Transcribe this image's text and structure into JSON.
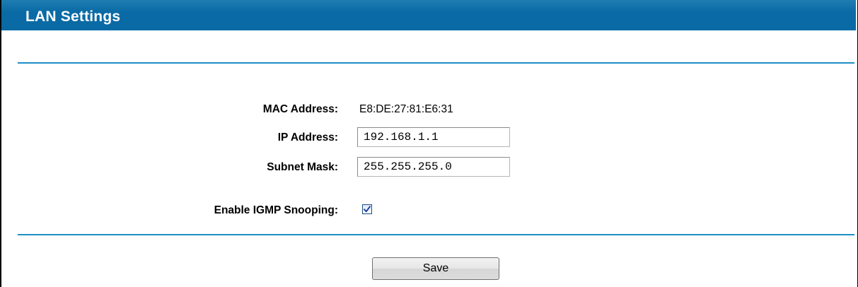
{
  "header": {
    "title": "LAN Settings"
  },
  "form": {
    "mac_address": {
      "label": "MAC Address:",
      "value": "E8:DE:27:81:E6:31"
    },
    "ip_address": {
      "label": "IP Address:",
      "value": "192.168.1.1"
    },
    "subnet_mask": {
      "label": "Subnet Mask:",
      "value": "255.255.255.0"
    },
    "igmp_snooping": {
      "label": "Enable IGMP Snooping:",
      "checked": true
    }
  },
  "actions": {
    "save_label": "Save"
  },
  "colors": {
    "header_background": "#0a6aa5",
    "divider": "#1f8ec5",
    "checkbox_check": "#1c3f9e"
  },
  "icons": {
    "checkbox_mark": "checkmark-icon"
  }
}
